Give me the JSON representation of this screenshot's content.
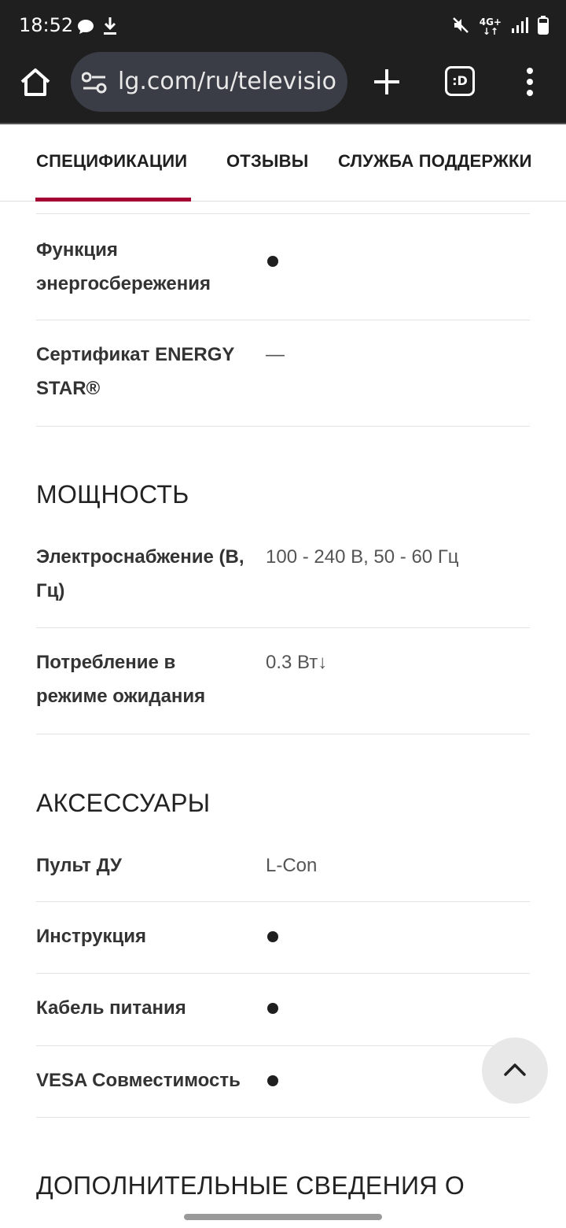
{
  "status_bar": {
    "time": "18:52",
    "network": "4G+",
    "icons": [
      "chat-icon",
      "download-icon",
      "mute-icon",
      "signal-icon",
      "battery-icon"
    ]
  },
  "browser": {
    "url": "lg.com/ru/televisions",
    "tabs_label": ":D",
    "icons": [
      "home-icon",
      "site-settings-icon",
      "new-tab-icon",
      "tabs-icon",
      "more-menu-icon"
    ]
  },
  "section_tabs": [
    {
      "label": "СПЕЦИФИКАЦИИ",
      "active": true
    },
    {
      "label": "ОТЗЫВЫ",
      "active": false
    },
    {
      "label": "СЛУЖБА ПОДДЕРЖКИ",
      "active": false
    }
  ],
  "accent_color": "#a50034",
  "specs": {
    "energy": {
      "rows": [
        {
          "label": "Функция энергосбережения",
          "value": "●"
        },
        {
          "label": "Сертификат ENERGY STAR®",
          "value": "—"
        }
      ]
    },
    "power": {
      "title": "МОЩНОСТЬ",
      "rows": [
        {
          "label": "Электроснабжение (В, Гц)",
          "value": "100 - 240 В, 50 - 60 Гц"
        },
        {
          "label": "Потребление в режиме ожидания",
          "value": "0.3 Вт↓"
        }
      ]
    },
    "accessories": {
      "title": "АКСЕССУАРЫ",
      "rows": [
        {
          "label": "Пульт ДУ",
          "value": "L-Con"
        },
        {
          "label": "Инструкция",
          "value": "●"
        },
        {
          "label": "Кабель питания",
          "value": "●"
        },
        {
          "label": "VESA Совместимость",
          "value": "●"
        }
      ]
    },
    "additional": {
      "title": "ДОПОЛНИТЕЛЬНЫЕ СВЕДЕНИЯ О"
    }
  }
}
